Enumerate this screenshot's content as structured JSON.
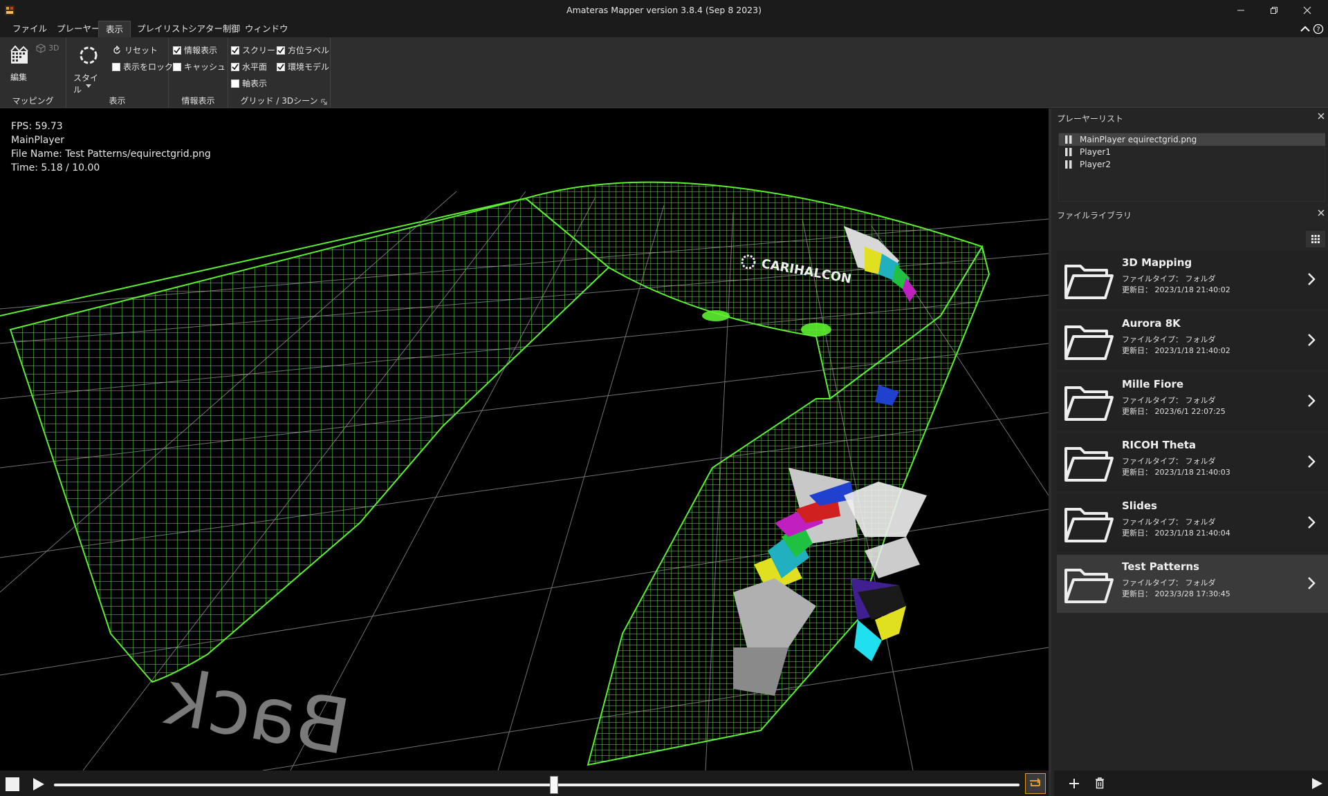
{
  "window": {
    "title": "Amateras Mapper version 3.8.4 (Sep  8 2023)"
  },
  "menu": {
    "items": [
      {
        "label": "ファイル"
      },
      {
        "label": "プレーヤー"
      },
      {
        "label": "表示",
        "active": true
      },
      {
        "label": "プレイリスト"
      },
      {
        "label": "シアター制御"
      },
      {
        "label": "ウィンドウ"
      }
    ]
  },
  "ribbon": {
    "mapping": {
      "edit_label": "編集",
      "view3d_label": "3D",
      "group_label": "マッピング"
    },
    "display": {
      "style_label": "スタイル",
      "reset_label": "リセット",
      "lock_label": "表示をロック",
      "lock_checked": false,
      "group_label": "表示"
    },
    "info": {
      "info_label": "情報表示",
      "info_checked": true,
      "cache_label": "キャッシュ",
      "cache_checked": false,
      "group_label": "情報表示"
    },
    "grid": {
      "screen_label": "スクリーン",
      "screen_checked": true,
      "direction_label": "方位ラベル",
      "direction_checked": true,
      "horizon_label": "水平面",
      "horizon_checked": true,
      "envmodel_label": "環境モデル",
      "envmodel_checked": true,
      "axis_label": "軸表示",
      "axis_checked": false,
      "group_label": "グリッド / 3Dシーン"
    }
  },
  "overlay": {
    "fps": "FPS: 59.73",
    "player": "MainPlayer",
    "file": "File Name: Test Patterns/equirectgrid.png",
    "time": "Time: 5.18 / 10.00"
  },
  "scene": {
    "back_label": "Back",
    "logo_text": "CARIHALCON"
  },
  "playback": {
    "progress": 0.518,
    "loop_color": "#e39b2c"
  },
  "player_list": {
    "title": "プレーヤーリスト",
    "items": [
      {
        "label": "MainPlayer  equirectgrid.png",
        "selected": true
      },
      {
        "label": "Player1"
      },
      {
        "label": "Player2"
      }
    ]
  },
  "file_library": {
    "title": "ファイルライブラリ",
    "items": [
      {
        "name": "3D Mapping",
        "type": "ファイルタイプ： フォルダ",
        "date": "更新日： 2023/1/18 21:40:02"
      },
      {
        "name": "Aurora 8K",
        "type": "ファイルタイプ： フォルダ",
        "date": "更新日： 2023/1/18 21:40:02"
      },
      {
        "name": "Mille Fiore",
        "type": "ファイルタイプ： フォルダ",
        "date": "更新日： 2023/6/1 22:07:25"
      },
      {
        "name": "RICOH Theta",
        "type": "ファイルタイプ： フォルダ",
        "date": "更新日： 2023/1/18 21:40:03"
      },
      {
        "name": "Slides",
        "type": "ファイルタイプ： フォルダ",
        "date": "更新日： 2023/1/18 21:40:04"
      },
      {
        "name": "Test Patterns",
        "type": "ファイルタイプ： フォルダ",
        "date": "更新日： 2023/3/28 17:30:45",
        "selected": true
      }
    ]
  }
}
